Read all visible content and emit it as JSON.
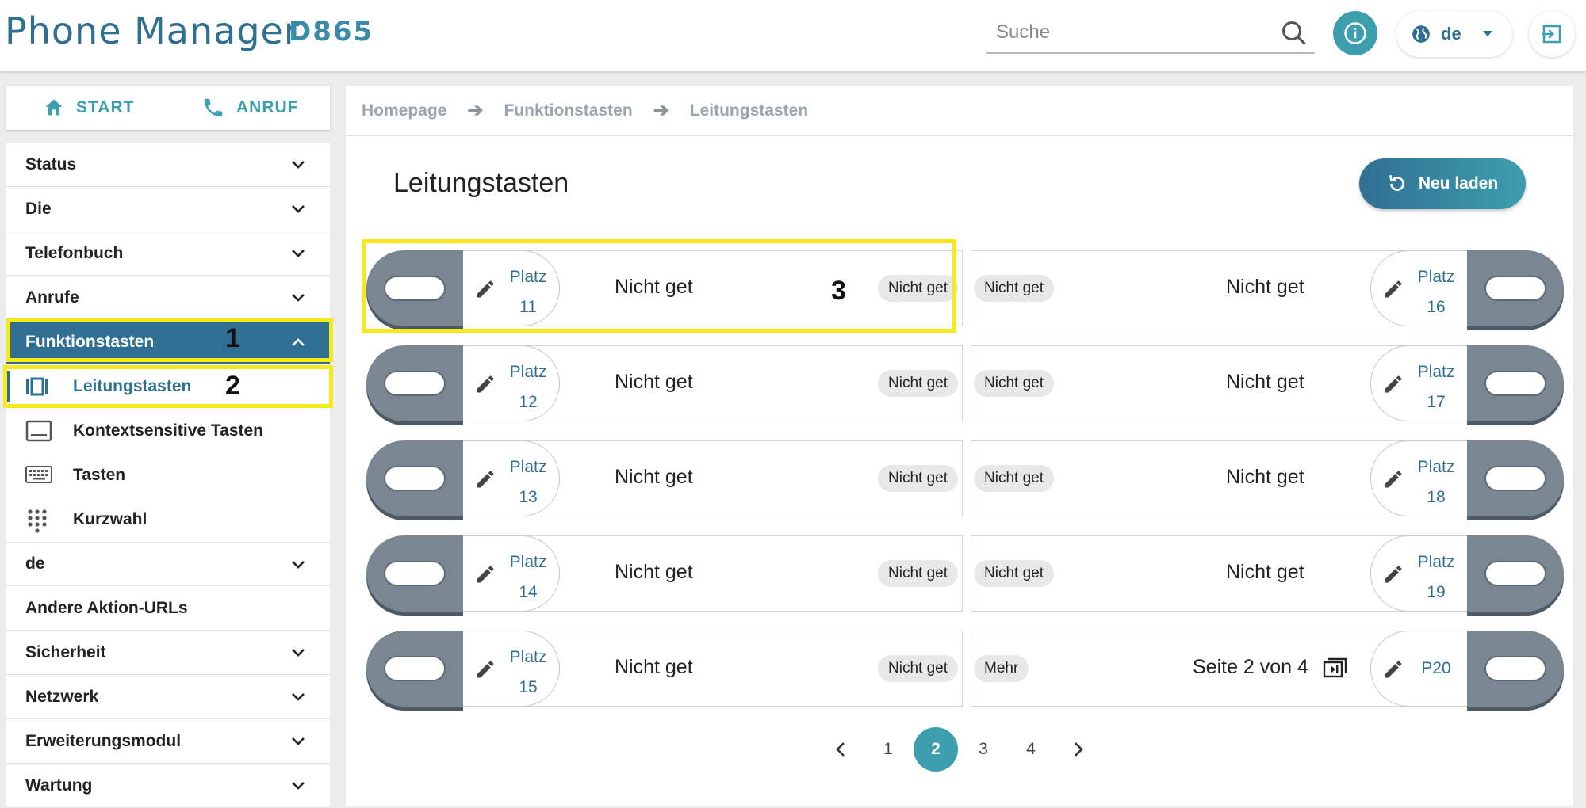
{
  "header": {
    "logo": "Phone Manager",
    "model": "D865",
    "search_placeholder": "Suche",
    "lang": "de"
  },
  "sidebar": {
    "start_label": "START",
    "call_label": "ANRUF",
    "items": [
      {
        "label": "Status"
      },
      {
        "label": "Die"
      },
      {
        "label": "Telefonbuch"
      },
      {
        "label": "Anrufe"
      },
      {
        "label": "Funktionstasten"
      },
      {
        "label": "de"
      },
      {
        "label": "Andere Aktion-URLs"
      },
      {
        "label": "Sicherheit"
      },
      {
        "label": "Netzwerk"
      },
      {
        "label": "Erweiterungsmodul"
      },
      {
        "label": "Wartung"
      }
    ],
    "subitems": [
      {
        "label": "Leitungstasten",
        "icon": "line-keys-icon"
      },
      {
        "label": "Kontextsensitive Tasten",
        "icon": "softkey-icon"
      },
      {
        "label": "Tasten",
        "icon": "keyboard-icon"
      },
      {
        "label": "Kurzwahl",
        "icon": "dialpad-icon"
      }
    ]
  },
  "breadcrumb": [
    "Homepage",
    "Funktionstasten",
    "Leitungstasten"
  ],
  "page": {
    "title": "Leitungstasten",
    "reload_label": "Neu laden"
  },
  "keys_left": [
    {
      "slot_label": "Platz",
      "slot_num": "11",
      "label": "Nicht get",
      "chip": "Nicht get"
    },
    {
      "slot_label": "Platz",
      "slot_num": "12",
      "label": "Nicht get",
      "chip": "Nicht get"
    },
    {
      "slot_label": "Platz",
      "slot_num": "13",
      "label": "Nicht get",
      "chip": "Nicht get"
    },
    {
      "slot_label": "Platz",
      "slot_num": "14",
      "label": "Nicht get",
      "chip": "Nicht get"
    },
    {
      "slot_label": "Platz",
      "slot_num": "15",
      "label": "Nicht get",
      "chip": "Nicht get"
    }
  ],
  "keys_right": [
    {
      "slot_label": "Platz",
      "slot_num": "16",
      "label": "Nicht get",
      "chip": "Nicht get"
    },
    {
      "slot_label": "Platz",
      "slot_num": "17",
      "label": "Nicht get",
      "chip": "Nicht get"
    },
    {
      "slot_label": "Platz",
      "slot_num": "18",
      "label": "Nicht get",
      "chip": "Nicht get"
    },
    {
      "slot_label": "Platz",
      "slot_num": "19",
      "label": "Nicht get",
      "chip": "Nicht get"
    },
    {
      "slot_label": "P20",
      "slot_num": "",
      "label": "Seite 2 von 4",
      "chip": "Mehr"
    }
  ],
  "pagination": {
    "pages": [
      "1",
      "2",
      "3",
      "4"
    ],
    "current": "2"
  },
  "annotations": [
    "1",
    "2",
    "3"
  ],
  "colors": {
    "primary": "#2f6f92",
    "accent": "#3d9eae",
    "highlight": "#f7ea1a",
    "key_grey": "#7a8792"
  }
}
